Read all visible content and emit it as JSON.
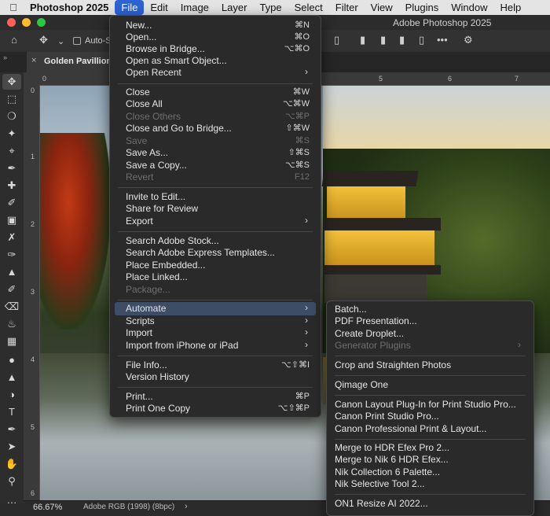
{
  "menubar": {
    "apple": "",
    "app_name": "Photoshop 2025",
    "items": [
      "File",
      "Edit",
      "Image",
      "Layer",
      "Type",
      "Select",
      "Filter",
      "View",
      "Plugins",
      "Window",
      "Help"
    ]
  },
  "window": {
    "title": "Adobe Photoshop 2025"
  },
  "options": {
    "auto_select": "Auto-S",
    "more": "•••"
  },
  "document": {
    "tab_name": "Golden Pavillion",
    "close": "×"
  },
  "rulers": {
    "h": [
      "0",
      "5",
      "6",
      "7"
    ],
    "v": [
      "0",
      "1",
      "2",
      "3",
      "4",
      "5",
      "6"
    ]
  },
  "status": {
    "zoom": "66.67%",
    "profile": "Adobe RGB (1998) (8bpc)",
    "arrow": "›"
  },
  "file_menu": {
    "items": [
      {
        "label": "New...",
        "shortcut": "⌘N"
      },
      {
        "label": "Open...",
        "shortcut": "⌘O"
      },
      {
        "label": "Browse in Bridge...",
        "shortcut": "⌥⌘O"
      },
      {
        "label": "Open as Smart Object..."
      },
      {
        "label": "Open Recent",
        "arrow": "›"
      },
      {
        "label": "Close",
        "shortcut": "⌘W"
      },
      {
        "label": "Close All",
        "shortcut": "⌥⌘W"
      },
      {
        "label": "Close Others",
        "shortcut": "⌥⌘P",
        "disabled": true
      },
      {
        "label": "Close and Go to Bridge...",
        "shortcut": "⇧⌘W"
      },
      {
        "label": "Save",
        "shortcut": "⌘S",
        "disabled": true
      },
      {
        "label": "Save As...",
        "shortcut": "⇧⌘S"
      },
      {
        "label": "Save a Copy...",
        "shortcut": "⌥⌘S"
      },
      {
        "label": "Revert",
        "shortcut": "F12",
        "disabled": true
      },
      {
        "label": "Invite to Edit..."
      },
      {
        "label": "Share for Review"
      },
      {
        "label": "Export",
        "arrow": "›"
      },
      {
        "label": "Search Adobe Stock..."
      },
      {
        "label": "Search Adobe Express Templates..."
      },
      {
        "label": "Place Embedded..."
      },
      {
        "label": "Place Linked..."
      },
      {
        "label": "Package...",
        "disabled": true
      },
      {
        "label": "Automate",
        "arrow": "›",
        "highlighted": true
      },
      {
        "label": "Scripts",
        "arrow": "›"
      },
      {
        "label": "Import",
        "arrow": "›"
      },
      {
        "label": "Import from iPhone or iPad",
        "arrow": "›"
      },
      {
        "label": "File Info...",
        "shortcut": "⌥⇧⌘I"
      },
      {
        "label": "Version History"
      },
      {
        "label": "Print...",
        "shortcut": "⌘P"
      },
      {
        "label": "Print One Copy",
        "shortcut": "⌥⇧⌘P"
      }
    ]
  },
  "automate_menu": {
    "items": [
      {
        "label": "Batch..."
      },
      {
        "label": "PDF Presentation..."
      },
      {
        "label": "Create Droplet..."
      },
      {
        "label": "Generator Plugins",
        "arrow": "›",
        "disabled": true
      },
      {
        "label": "Crop and Straighten Photos"
      },
      {
        "label": "Qimage One"
      },
      {
        "label": "Canon Layout Plug-In for Print Studio Pro..."
      },
      {
        "label": "Canon Print Studio Pro..."
      },
      {
        "label": "Canon Professional Print & Layout..."
      },
      {
        "label": "Merge to HDR Efex Pro 2..."
      },
      {
        "label": "Merge to Nik 6 HDR Efex..."
      },
      {
        "label": "Nik Collection 6 Palette..."
      },
      {
        "label": "Nik Selective Tool 2..."
      },
      {
        "label": "ON1 Resize AI 2022..."
      }
    ]
  }
}
